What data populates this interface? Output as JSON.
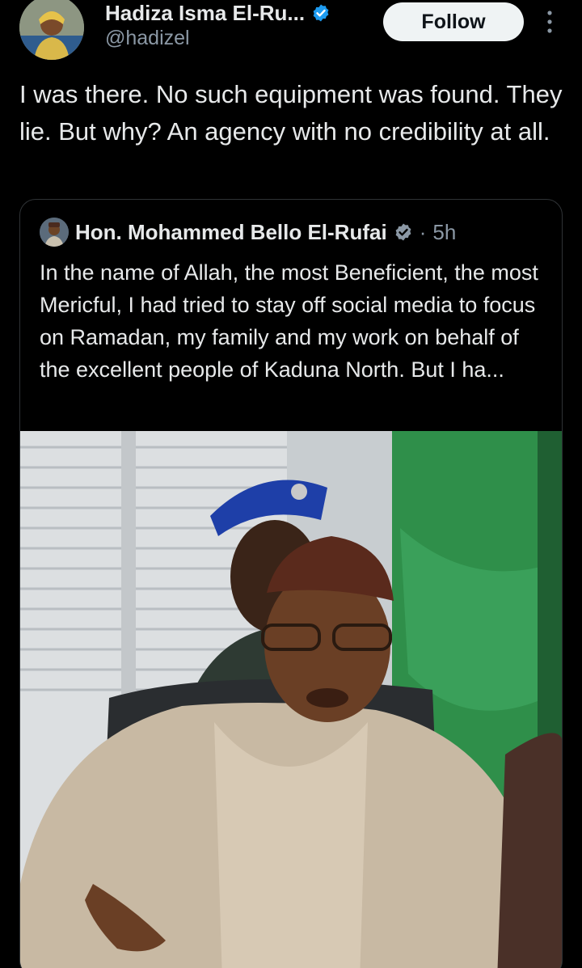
{
  "author": {
    "display_name": "Hadiza Isma El-Ru...",
    "handle": "@hadizel",
    "verified": true
  },
  "follow_button": {
    "label": "Follow"
  },
  "more_menu": {
    "icon": "more-vertical-icon"
  },
  "tweet": {
    "text": "I was there. No such equipment was found. They lie. But why? An agency with no credibility at all."
  },
  "quoted_tweet": {
    "display_name": "Hon. Mohammed Bello El-Rufai",
    "verified": true,
    "separator": "·",
    "time": "5h",
    "text": "In the name of Allah, the most Beneficient, the most Mericful, I had tried to stay off social media to focus on Ramadan, my family and my work on behalf of the excellent people of Kaduna North. But I ha...",
    "media": {
      "kind": "photo"
    }
  },
  "colors": {
    "background": "#000000",
    "text_primary": "#e7e9ea",
    "text_secondary": "#8b98a5",
    "verified_blue": "#1d9bf0",
    "border": "#2f3336",
    "follow_bg": "#eff3f4"
  }
}
